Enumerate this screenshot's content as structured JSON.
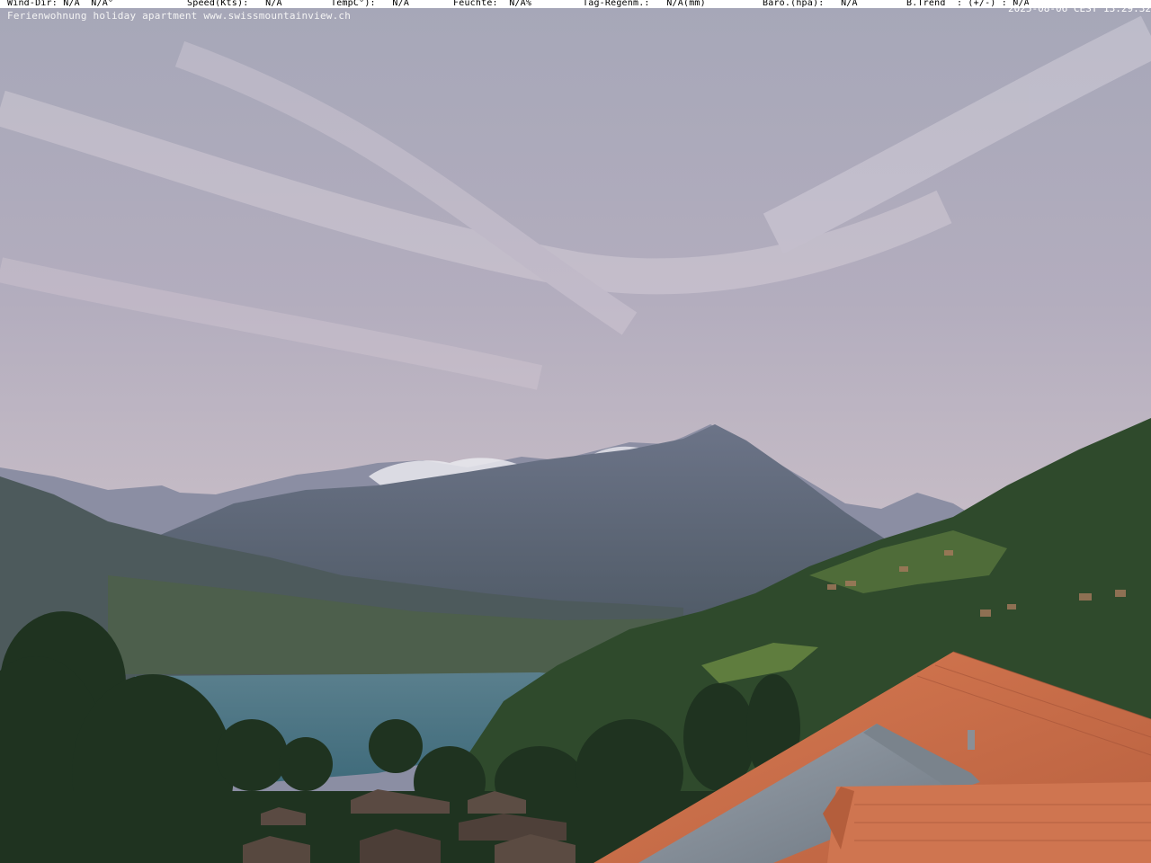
{
  "overlay": {
    "wind_dir": "Wind-Dir: N/A  N/A°",
    "speed": "Speed(Kts):   N/A",
    "temp": "TempC°):   N/A",
    "feuchte": "Feuchte:  N/A%",
    "regen": "Tag-Regenm.:   N/A(mm)",
    "baro": "Baro.(hpa):   N/A",
    "trend": "B.Trend  : (+/-) : N/A",
    "caption": "Ferienwohnung holiday apartment www.swissmountainview.ch",
    "timestamp": "2025-08-06 CEST 13:29:32"
  }
}
